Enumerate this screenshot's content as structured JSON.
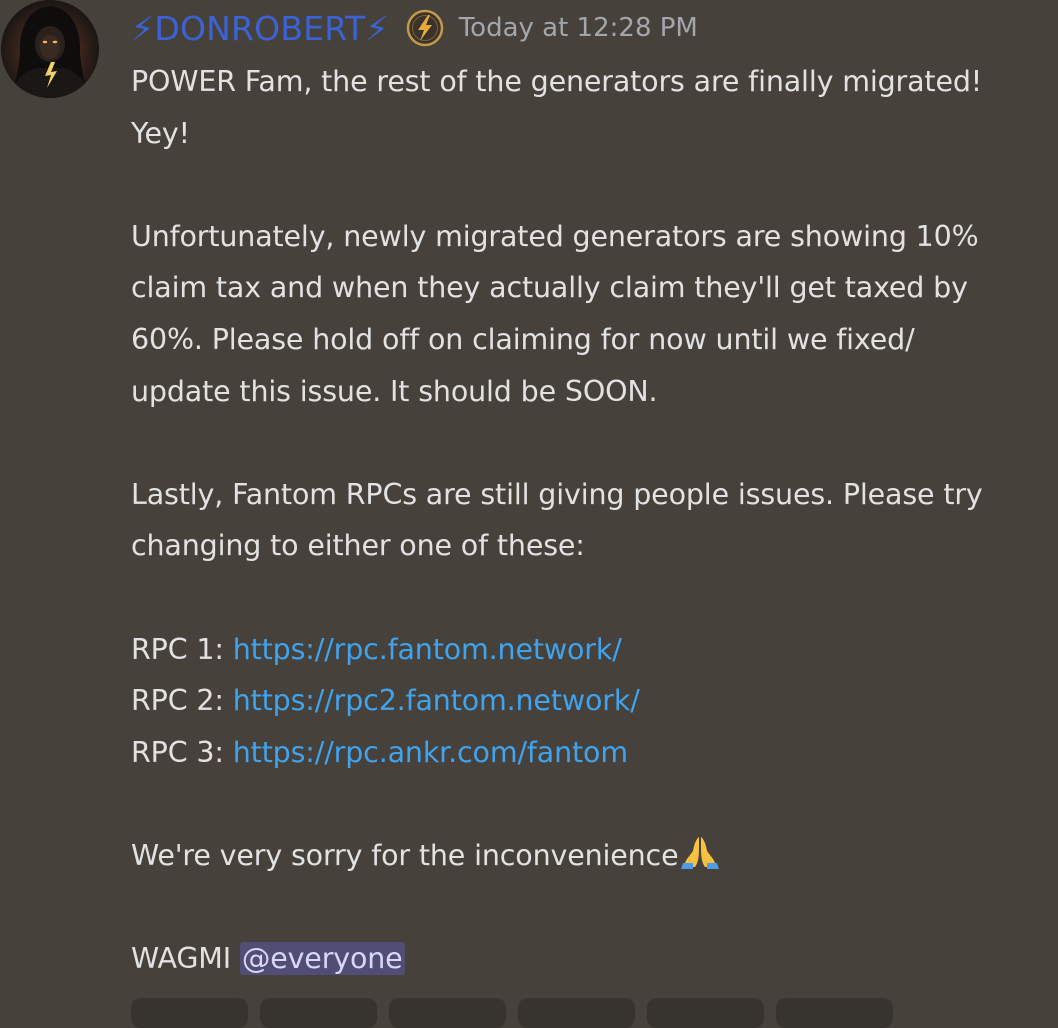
{
  "message": {
    "author": {
      "username": "⚡DONROBERT⚡",
      "avatar_icon": "hooded-figure-avatar",
      "badge_icon": "lightning-coin-icon"
    },
    "timestamp": "Today at 12:28 PM",
    "body": {
      "line1": "POWER Fam, the rest of the generators are finally migrated!",
      "line2": "Yey!",
      "p2_line1": "Unfortunately, newly migrated generators are showing 10%",
      "p2_line2": "claim tax and when they actually claim they'll get taxed by",
      "p2_line3": "60%. Please hold off on claiming for now until we fixed/",
      "p2_line4": "update this issue. It should be SOON.",
      "p3_line1": "Lastly, Fantom RPCs are still giving people issues. Please try",
      "p3_line2": "changing to either one of these:",
      "rpcs": [
        {
          "label": "RPC 1: ",
          "url": "https://rpc.fantom.network/"
        },
        {
          "label": "RPC 2: ",
          "url": "https://rpc2.fantom.network/"
        },
        {
          "label": "RPC 3: ",
          "url": "https://rpc.ankr.com/fantom"
        }
      ],
      "apology": "We're very sorry for the inconvenience",
      "apology_emoji": "folded-hands-icon",
      "wagmi": "WAGMI ",
      "mention": "@everyone"
    },
    "reaction_count_visible": 6
  },
  "colors": {
    "background": "#46413a",
    "username": "#3b63d6",
    "link": "#3fa3ee",
    "mention_bg": "#514d74",
    "timestamp": "#a3a6aa"
  }
}
